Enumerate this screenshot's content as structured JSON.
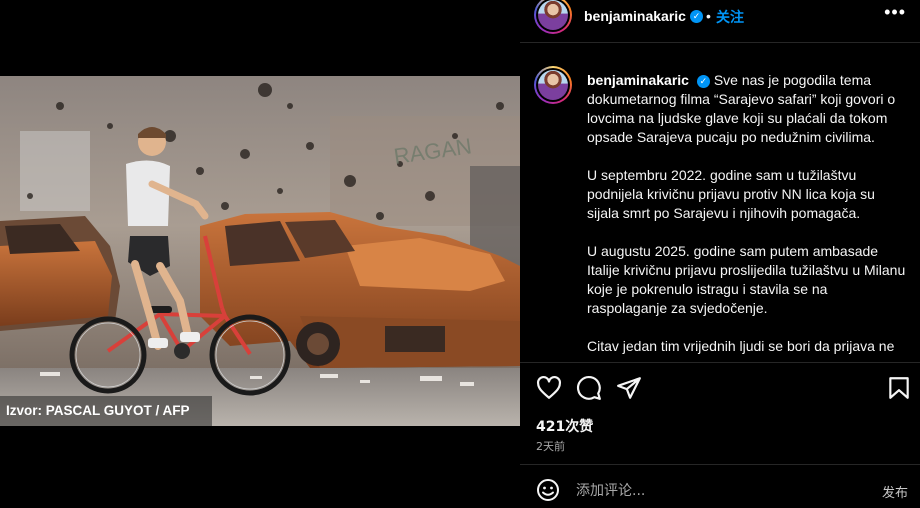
{
  "media": {
    "credit": "Izvor: PASCAL GUYOT / AFP"
  },
  "account": {
    "username": "benjaminakaric",
    "verified_mark": "✓",
    "dot": "•",
    "follow_label": "关注",
    "more_label": "•••"
  },
  "caption": {
    "username": "benjaminakaric",
    "paragraphs": [
      "Sve nas je pogodila tema dokumetarnog filma “Sarajevo safari” koji govori o lovcima na ljudske glave koji su plaćali da tokom opsade Sarajeva pucaju po nedužnim civilima.",
      "U septembru 2022. godine sam u tužilaštvu podnijela krivičnu prijavu protiv NN lica koja su sijala smrt po Sarajevu i njihovih pomagača.",
      "U augustu 2025. godine sam putem ambasade Italije krivičnu prijavu proslijedila tužilaštvu u Milanu koje je pokrenulo istragu i stavila se na raspolaganje za svjedočenje.",
      "Citav jedan tim vrijednih ljudi se bori da prijava ne"
    ]
  },
  "actions": {
    "icons": [
      "heart-icon",
      "comment-icon",
      "share-icon",
      "bookmark-icon"
    ]
  },
  "stats": {
    "likes": "421次赞",
    "posted": "2天前"
  },
  "comment": {
    "placeholder": "添加评论...",
    "post_label": "发布"
  }
}
